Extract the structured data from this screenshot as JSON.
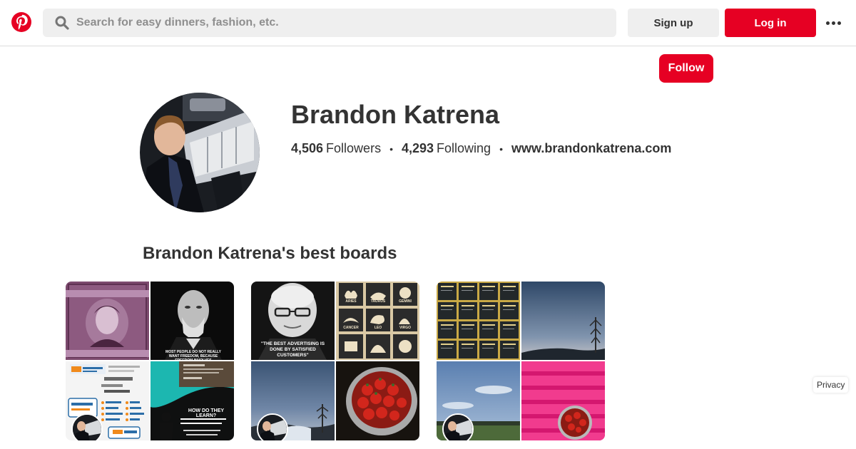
{
  "header": {
    "logo_icon": "pinterest-logo-icon",
    "search_placeholder": "Search for easy dinners, fashion, etc.",
    "search_icon": "search-icon",
    "signup_label": "Sign up",
    "login_label": "Log in",
    "more_icon": "more-dots-icon"
  },
  "profile": {
    "follow_label": "Follow",
    "name": "Brandon Katrena",
    "followers_count": "4,506",
    "followers_label": "Followers",
    "following_count": "4,293",
    "following_label": "Following",
    "separator": "•",
    "website": "www.brandonkatrena.com"
  },
  "boards_section": {
    "title": "Brandon Katrena's best boards"
  },
  "boards": [
    {
      "tiles": [
        {
          "name": "stamp-image",
          "caption": ""
        },
        {
          "name": "freud-portrait-image",
          "caption": "MOST PEOPLE DO NOT REALLY WANT FREEDOM, BECAUSE FREEDOM INVOLVES"
        },
        {
          "name": "fonts-infographic-image",
          "caption": ""
        },
        {
          "name": "learning-infographic-image",
          "caption": "HOW DO THEY LEARN?"
        }
      ]
    },
    {
      "tiles": [
        {
          "name": "advertising-quote-image",
          "caption": "\"THE BEST ADVERTISING IS DONE BY SATISFIED CUSTOMERS\""
        },
        {
          "name": "zodiac-signs-image",
          "caption": ""
        },
        {
          "name": "sky-photo-image",
          "caption": ""
        },
        {
          "name": "strawberries-bowl-image",
          "caption": ""
        }
      ],
      "zodiac_labels": [
        "ARIES",
        "TAURUS",
        "GEMINI",
        "CANCER",
        "LEO",
        "VIRGO"
      ]
    },
    {
      "tiles": [
        {
          "name": "teaching-grid-image",
          "caption": ""
        },
        {
          "name": "evening-sky-image",
          "caption": ""
        },
        {
          "name": "field-sky-image",
          "caption": ""
        },
        {
          "name": "pink-chair-image",
          "caption": ""
        }
      ]
    }
  ],
  "footer": {
    "privacy_label": "Privacy"
  },
  "colors": {
    "brand_red": "#e60023",
    "search_bg": "#efefef",
    "text": "#333333"
  }
}
